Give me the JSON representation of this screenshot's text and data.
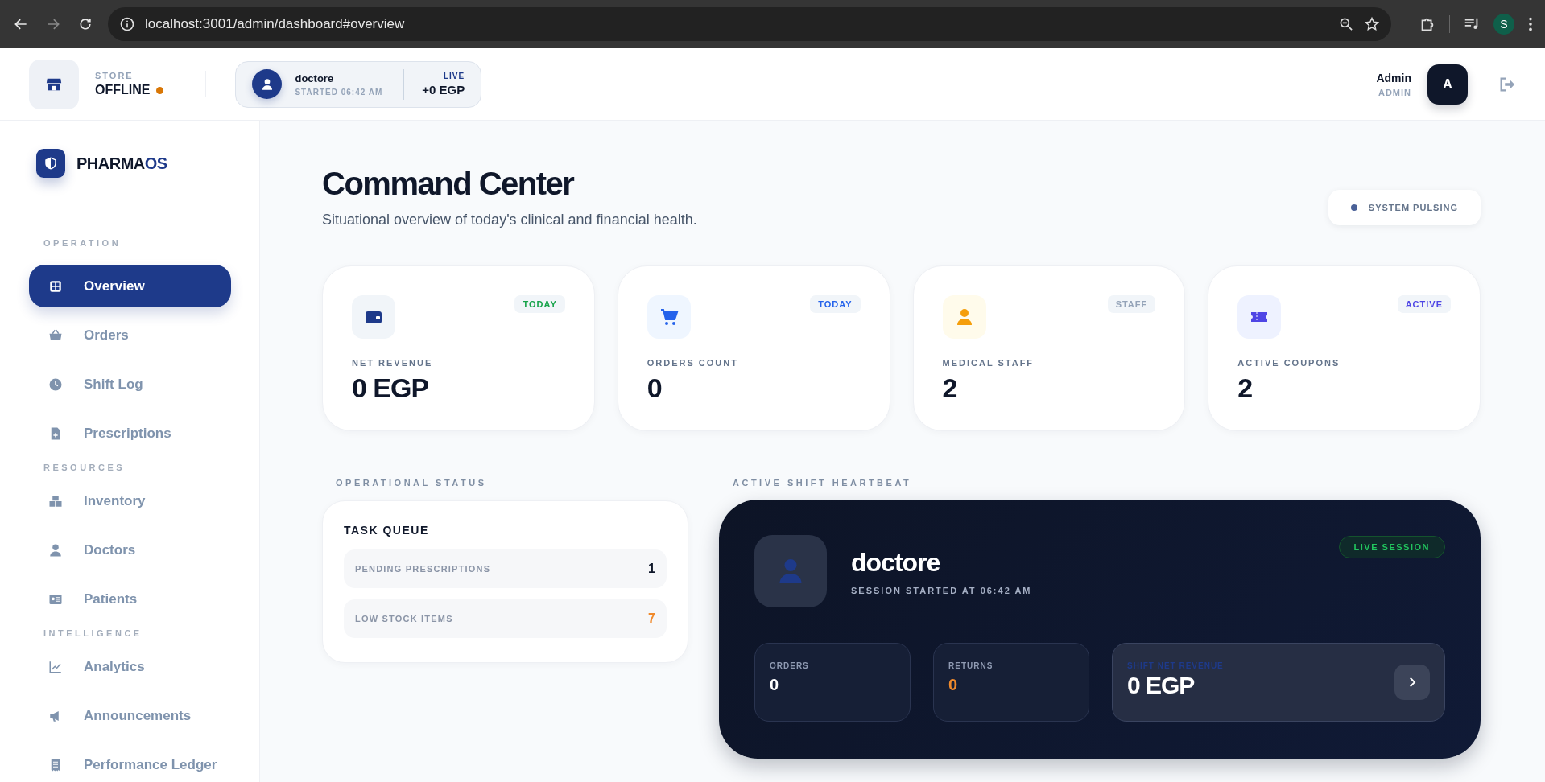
{
  "browser": {
    "url": "localhost:3001/admin/dashboard#overview",
    "profile": "S"
  },
  "header": {
    "store": {
      "label": "STORE",
      "status": "OFFLINE",
      "color": "#d97706"
    },
    "shift": {
      "name": "doctore",
      "started": "STARTED 06:42 AM",
      "live": "LIVE",
      "amount": "+0 EGP"
    },
    "user": {
      "name": "Admin",
      "role": "ADMIN",
      "avatar": "A"
    }
  },
  "sidebar": {
    "brand": {
      "main": "PHARMA",
      "accent": "OS"
    },
    "sections": [
      {
        "title": "OPERATION",
        "items": [
          {
            "label": "Overview",
            "selected": true
          },
          {
            "label": "Orders",
            "selected": false
          },
          {
            "label": "Shift Log",
            "selected": false
          },
          {
            "label": "Prescriptions",
            "selected": false
          }
        ]
      },
      {
        "title": "RESOURCES",
        "items": [
          {
            "label": "Inventory",
            "selected": false
          },
          {
            "label": "Doctors",
            "selected": false
          },
          {
            "label": "Patients",
            "selected": false
          }
        ]
      },
      {
        "title": "INTELLIGENCE",
        "items": [
          {
            "label": "Analytics",
            "selected": false
          },
          {
            "label": "Announcements",
            "selected": false
          },
          {
            "label": "Performance Ledger",
            "selected": false
          }
        ]
      }
    ]
  },
  "page": {
    "title": "Command Center",
    "subtitle": "Situational overview of today's clinical and financial health.",
    "status_pill": "SYSTEM PULSING"
  },
  "stats": [
    {
      "label": "NET REVENUE",
      "value": "0 EGP",
      "tag": "TODAY",
      "color": "#16a34a"
    },
    {
      "label": "ORDERS COUNT",
      "value": "0",
      "tag": "TODAY",
      "color": "#2563eb"
    },
    {
      "label": "MEDICAL STAFF",
      "value": "2",
      "tag": "STAFF",
      "color": "#94a3b8"
    },
    {
      "label": "ACTIVE COUPONS",
      "value": "2",
      "tag": "ACTIVE",
      "color": "#4f46e5"
    }
  ],
  "operational": {
    "title": "OPERATIONAL STATUS",
    "card_title": "TASK QUEUE",
    "rows": [
      {
        "label": "PENDING PRESCRIPTIONS",
        "value": "1",
        "alert": false
      },
      {
        "label": "LOW STOCK ITEMS",
        "value": "7",
        "alert": true
      }
    ]
  },
  "heartbeat": {
    "title": "ACTIVE SHIFT HEARTBEAT",
    "name": "doctore",
    "session": "SESSION STARTED AT 06:42 AM",
    "badge": "LIVE SESSION",
    "metrics": [
      {
        "kind": "count",
        "label": "ORDERS",
        "value": "0",
        "alert": false
      },
      {
        "kind": "count",
        "label": "RETURNS",
        "value": "0",
        "alert": true
      },
      {
        "kind": "revenue",
        "label": "SHIFT NET REVENUE",
        "value": "0 EGP",
        "alert": false
      }
    ]
  }
}
